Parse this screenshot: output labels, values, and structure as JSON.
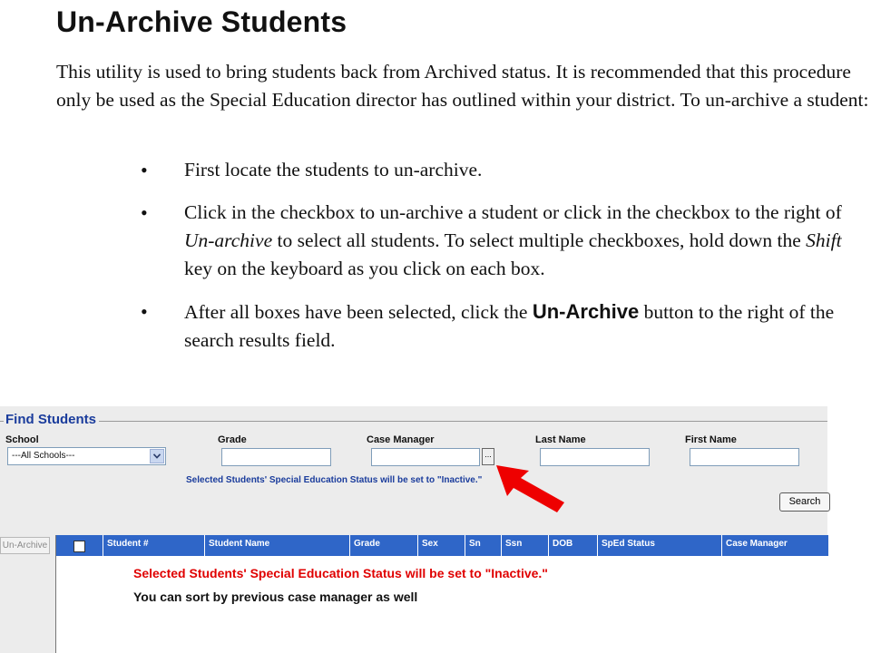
{
  "document": {
    "title": "Un-Archive Students",
    "intro": "This utility is used to bring students back from Archived status. It is recommended that this procedure only be used as the Special Education director has outlined within your district. To un-archive a student:",
    "bullets": [
      {
        "text": "First locate the students to un-archive."
      },
      {
        "pre": "Click in the checkbox to un-archive a student or click in the checkbox to the right of ",
        "em1": "Un-archive",
        "mid": " to select all students. To select multiple checkboxes, hold down the ",
        "em2": "Shift",
        "post": " key on the keyboard as you click on each box."
      },
      {
        "pre": "After all boxes have been selected, click the ",
        "strong": "Un-Archive",
        "post": " button to the right of the search results field."
      }
    ]
  },
  "find": {
    "legend": "Find Students",
    "school_label": "School",
    "school_value": "---All Schools---",
    "grade_label": "Grade",
    "case_manager_label": "Case Manager",
    "ellipsis_label": "...",
    "last_name_label": "Last Name",
    "first_name_label": "First Name",
    "status_message": "Selected Students' Special Education Status will be set to \"Inactive.\"",
    "search_label": "Search"
  },
  "results": {
    "unarchive_label": "Un-Archive",
    "columns": [
      "Student #",
      "Student Name",
      "Grade",
      "Sex",
      "Sn",
      "Ssn",
      "DOB",
      "SpEd Status",
      "Case Manager"
    ]
  },
  "annotations": {
    "red_note": "Selected Students' Special Education Status will be set to \"Inactive.\"",
    "black_note": "You can sort by previous case manager as well",
    "arrow_color": "#ee0000"
  },
  "colors": {
    "header_blue": "#2f66c8",
    "legend_blue": "#1a3c9c",
    "note_red": "#e00000"
  }
}
